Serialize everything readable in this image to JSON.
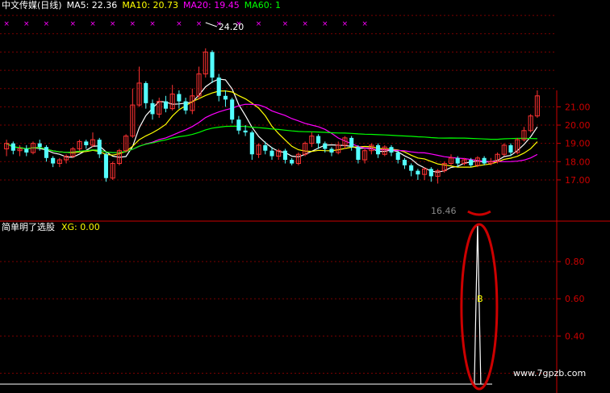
{
  "header": {
    "stock_name": "中文传媒(日线)",
    "ma5_label": "MA5: 22.36",
    "ma10_label": "MA10: 20.73",
    "ma20_label": "MA20: 19.45",
    "ma60_label": "MA60: 1",
    "colors": {
      "name": "#ffffff",
      "ma5": "#ffffff",
      "ma10": "#ffff00",
      "ma20": "#ff00ff",
      "ma60": "#00ff00"
    }
  },
  "indicator_header": {
    "name": "简单明了选股",
    "value_label": "XG: 0.00",
    "colors": {
      "name": "#ffffff",
      "value": "#ffff00"
    }
  },
  "watermark": "www.7gpzb.com",
  "chart_data": [
    {
      "type": "candlestick",
      "title": "中文传媒(日线)",
      "ylim": [
        16.6,
        21.9
      ],
      "y_ticks": [
        "21.00",
        "20.00",
        "19.00",
        "18.00",
        "17.00"
      ],
      "grid": "horizontal dashed, red",
      "annotations": [
        {
          "text": "24.20",
          "kind": "high-marker",
          "color": "#ffffff"
        },
        {
          "text": "16.46",
          "kind": "low-marker",
          "partially_hidden": true
        }
      ],
      "signal_marks": {
        "symbol": "×",
        "color": "#ff00ff",
        "count": 18
      },
      "candles": [
        {
          "o": 18.7,
          "c": 19.0,
          "h": 19.2,
          "l": 18.3
        },
        {
          "o": 19.0,
          "c": 18.6,
          "h": 19.1,
          "l": 18.4
        },
        {
          "o": 18.6,
          "c": 18.7,
          "h": 18.9,
          "l": 18.3
        },
        {
          "o": 18.7,
          "c": 18.5,
          "h": 18.9,
          "l": 18.3
        },
        {
          "o": 18.5,
          "c": 19.0,
          "h": 19.1,
          "l": 18.4
        },
        {
          "o": 19.0,
          "c": 18.8,
          "h": 19.2,
          "l": 18.6
        },
        {
          "o": 18.8,
          "c": 18.2,
          "h": 18.9,
          "l": 18.0
        },
        {
          "o": 18.2,
          "c": 17.9,
          "h": 18.3,
          "l": 17.7
        },
        {
          "o": 17.9,
          "c": 18.1,
          "h": 18.2,
          "l": 17.7
        },
        {
          "o": 18.1,
          "c": 18.3,
          "h": 18.4,
          "l": 17.9
        },
        {
          "o": 18.3,
          "c": 18.7,
          "h": 18.8,
          "l": 18.2
        },
        {
          "o": 18.7,
          "c": 19.1,
          "h": 19.2,
          "l": 18.6
        },
        {
          "o": 19.1,
          "c": 18.9,
          "h": 19.2,
          "l": 18.7
        },
        {
          "o": 18.9,
          "c": 19.2,
          "h": 19.6,
          "l": 18.8
        },
        {
          "o": 19.2,
          "c": 18.4,
          "h": 19.3,
          "l": 18.2
        },
        {
          "o": 18.4,
          "c": 17.1,
          "h": 18.5,
          "l": 16.9
        },
        {
          "o": 17.1,
          "c": 17.9,
          "h": 18.0,
          "l": 17.0
        },
        {
          "o": 17.9,
          "c": 18.6,
          "h": 18.7,
          "l": 17.8
        },
        {
          "o": 18.6,
          "c": 19.4,
          "h": 19.5,
          "l": 18.5
        },
        {
          "o": 19.4,
          "c": 21.1,
          "h": 22.0,
          "l": 19.3
        },
        {
          "o": 21.1,
          "c": 22.3,
          "h": 23.2,
          "l": 21.0
        },
        {
          "o": 22.3,
          "c": 21.2,
          "h": 22.4,
          "l": 20.9
        },
        {
          "o": 21.2,
          "c": 20.6,
          "h": 21.4,
          "l": 20.3
        },
        {
          "o": 20.6,
          "c": 21.3,
          "h": 21.5,
          "l": 20.4
        },
        {
          "o": 21.3,
          "c": 20.9,
          "h": 21.6,
          "l": 20.7
        },
        {
          "o": 20.9,
          "c": 21.7,
          "h": 22.2,
          "l": 20.8
        },
        {
          "o": 21.7,
          "c": 21.3,
          "h": 21.9,
          "l": 20.9
        },
        {
          "o": 21.3,
          "c": 20.8,
          "h": 21.5,
          "l": 20.6
        },
        {
          "o": 20.8,
          "c": 21.6,
          "h": 22.0,
          "l": 20.6
        },
        {
          "o": 21.6,
          "c": 22.8,
          "h": 23.2,
          "l": 21.4
        },
        {
          "o": 22.8,
          "c": 24.0,
          "h": 24.2,
          "l": 22.6
        },
        {
          "o": 24.0,
          "c": 22.6,
          "h": 24.1,
          "l": 22.3
        },
        {
          "o": 22.6,
          "c": 21.6,
          "h": 22.8,
          "l": 21.3
        },
        {
          "o": 21.6,
          "c": 21.4,
          "h": 21.9,
          "l": 21.0
        },
        {
          "o": 21.4,
          "c": 20.3,
          "h": 21.5,
          "l": 20.1
        },
        {
          "o": 20.3,
          "c": 19.7,
          "h": 20.5,
          "l": 19.5
        },
        {
          "o": 19.7,
          "c": 19.6,
          "h": 20.0,
          "l": 19.4
        },
        {
          "o": 19.6,
          "c": 18.4,
          "h": 19.7,
          "l": 18.1
        },
        {
          "o": 18.4,
          "c": 18.9,
          "h": 19.0,
          "l": 18.2
        },
        {
          "o": 18.9,
          "c": 18.6,
          "h": 19.1,
          "l": 18.4
        },
        {
          "o": 18.6,
          "c": 18.3,
          "h": 18.8,
          "l": 18.1
        },
        {
          "o": 18.3,
          "c": 18.6,
          "h": 18.7,
          "l": 18.1
        },
        {
          "o": 18.6,
          "c": 18.1,
          "h": 18.7,
          "l": 17.9
        },
        {
          "o": 18.1,
          "c": 17.9,
          "h": 18.2,
          "l": 17.8
        },
        {
          "o": 17.9,
          "c": 18.4,
          "h": 18.5,
          "l": 17.8
        },
        {
          "o": 18.4,
          "c": 19.0,
          "h": 19.1,
          "l": 18.3
        },
        {
          "o": 19.0,
          "c": 19.4,
          "h": 19.6,
          "l": 18.8
        },
        {
          "o": 19.4,
          "c": 19.0,
          "h": 19.5,
          "l": 18.7
        },
        {
          "o": 19.0,
          "c": 18.7,
          "h": 19.1,
          "l": 18.5
        },
        {
          "o": 18.7,
          "c": 18.5,
          "h": 18.8,
          "l": 18.3
        },
        {
          "o": 18.5,
          "c": 18.9,
          "h": 19.1,
          "l": 18.4
        },
        {
          "o": 18.9,
          "c": 19.3,
          "h": 19.4,
          "l": 18.7
        },
        {
          "o": 19.3,
          "c": 18.8,
          "h": 19.4,
          "l": 18.6
        },
        {
          "o": 18.8,
          "c": 18.1,
          "h": 18.9,
          "l": 17.9
        },
        {
          "o": 18.1,
          "c": 18.6,
          "h": 18.7,
          "l": 17.9
        },
        {
          "o": 18.6,
          "c": 18.9,
          "h": 19.0,
          "l": 18.4
        },
        {
          "o": 18.9,
          "c": 18.4,
          "h": 19.0,
          "l": 18.2
        },
        {
          "o": 18.4,
          "c": 18.8,
          "h": 18.9,
          "l": 18.3
        },
        {
          "o": 18.8,
          "c": 18.5,
          "h": 18.9,
          "l": 18.3
        },
        {
          "o": 18.5,
          "c": 18.1,
          "h": 18.6,
          "l": 17.9
        },
        {
          "o": 18.1,
          "c": 17.8,
          "h": 18.2,
          "l": 17.6
        },
        {
          "o": 17.8,
          "c": 17.5,
          "h": 17.9,
          "l": 17.2
        },
        {
          "o": 17.5,
          "c": 17.3,
          "h": 17.6,
          "l": 17.0
        },
        {
          "o": 17.3,
          "c": 17.6,
          "h": 17.7,
          "l": 17.0
        },
        {
          "o": 17.6,
          "c": 17.2,
          "h": 17.7,
          "l": 16.9
        },
        {
          "o": 17.2,
          "c": 17.5,
          "h": 17.6,
          "l": 16.8
        },
        {
          "o": 17.5,
          "c": 17.9,
          "h": 18.0,
          "l": 17.4
        },
        {
          "o": 17.9,
          "c": 18.2,
          "h": 18.4,
          "l": 17.8
        },
        {
          "o": 18.2,
          "c": 17.9,
          "h": 18.3,
          "l": 17.7
        },
        {
          "o": 17.9,
          "c": 18.1,
          "h": 18.2,
          "l": 17.8
        },
        {
          "o": 18.1,
          "c": 17.8,
          "h": 18.2,
          "l": 17.7
        },
        {
          "o": 17.8,
          "c": 18.2,
          "h": 18.3,
          "l": 17.7
        },
        {
          "o": 18.2,
          "c": 17.9,
          "h": 18.3,
          "l": 17.8
        },
        {
          "o": 17.9,
          "c": 18.0,
          "h": 18.2,
          "l": 17.8
        },
        {
          "o": 18.0,
          "c": 18.4,
          "h": 18.5,
          "l": 17.9
        },
        {
          "o": 18.4,
          "c": 18.9,
          "h": 19.0,
          "l": 18.3
        },
        {
          "o": 18.9,
          "c": 18.5,
          "h": 19.0,
          "l": 18.3
        },
        {
          "o": 18.5,
          "c": 19.2,
          "h": 19.3,
          "l": 18.4
        },
        {
          "o": 19.2,
          "c": 19.7,
          "h": 19.9,
          "l": 19.1
        },
        {
          "o": 19.7,
          "c": 20.5,
          "h": 20.6,
          "l": 19.6
        },
        {
          "o": 20.5,
          "c": 21.6,
          "h": 21.9,
          "l": 20.4
        }
      ],
      "series": [
        {
          "name": "MA5",
          "color": "#ffffff"
        },
        {
          "name": "MA10",
          "color": "#ffff00"
        },
        {
          "name": "MA20",
          "color": "#ff00ff"
        },
        {
          "name": "MA60",
          "color": "#00ff00"
        }
      ]
    },
    {
      "type": "line",
      "title": "简单明了选股",
      "ylim": [
        0.15,
        1.0
      ],
      "y_ticks": [
        "0.80",
        "0.60",
        "0.40"
      ],
      "grid": "horizontal dashed, red",
      "series": [
        {
          "name": "XG",
          "color": "#ffffff",
          "spike_at_candle_index": 71,
          "peak_value": 1.0
        }
      ],
      "annotations": [
        {
          "text": "B",
          "color": "#ffff00",
          "y": 0.6
        }
      ],
      "highlight": {
        "shape": "ellipse",
        "color": "#cc0000"
      }
    }
  ]
}
